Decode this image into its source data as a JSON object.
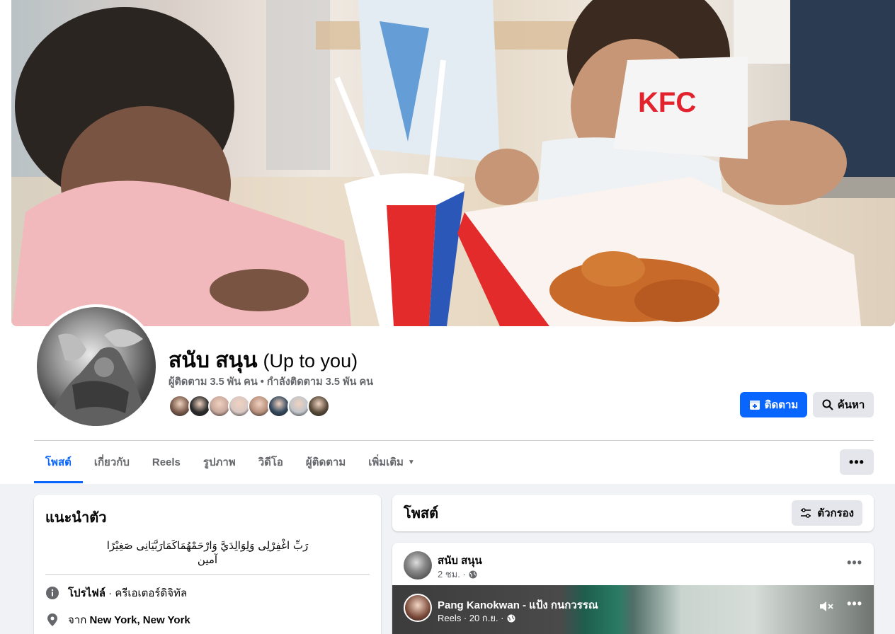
{
  "profile": {
    "name": "สนับ สนุน",
    "name_alt": "(Up to you)",
    "followers_line": "ผู้ติดตาม 3.5 พัน คน • กำลังติดตาม 3.5 พัน คน",
    "follow_button": "ติดตาม",
    "search_button": "ค้นหา",
    "friend_colors": [
      "#7a5b4b",
      "#2b2b2b",
      "#c7a79b",
      "#d8c7c2",
      "#b68f7b",
      "#34495e",
      "#c0c4ca",
      "#5a4b3a"
    ]
  },
  "cover": {
    "logo_text": "KFC"
  },
  "tabs": [
    {
      "label": "โพสต์",
      "active": true
    },
    {
      "label": "เกี่ยวกับ",
      "active": false
    },
    {
      "label": "Reels",
      "active": false
    },
    {
      "label": "รูปภาพ",
      "active": false
    },
    {
      "label": "วิดีโอ",
      "active": false
    },
    {
      "label": "ผู้ติดตาม",
      "active": false
    },
    {
      "label": "เพิ่มเติม",
      "active": false
    }
  ],
  "tab_more_label": "•••",
  "intro": {
    "title": "แนะนำตัว",
    "bio_line1": "رَبِّ اغْفِرْلِى وَلِوَالِدَيَّ وَارْحَمْهُمَاكَمَارَبَّيَانِى صَغِيْرًا",
    "bio_line2": "آمين",
    "profile_label": "โปรไฟล์",
    "profile_value": " · ครีเอเตอร์ดิจิทัล",
    "from_prefix": "จาก ",
    "from_place": "New York, New York"
  },
  "posts": {
    "title": "โพสต์",
    "filter_label": "ตัวกรอง"
  },
  "post": {
    "author": "สนับ สนุน",
    "time": "2 ชม. ·",
    "dots": "•••",
    "reel_author": "Pang Kanokwan - แป้ง กนกวรรณ",
    "reel_meta": "Reels · 20 ก.ย. ·",
    "reel_dots": "•••"
  },
  "colors": {
    "accent": "#0866ff",
    "secondary_text": "#65676b",
    "button_grey": "#e4e6eb"
  }
}
